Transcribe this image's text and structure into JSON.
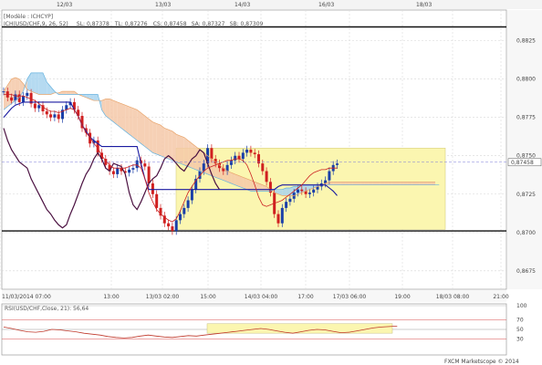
{
  "header": {
    "dates": [
      "12/03",
      "13/03",
      "14/03",
      "16/03",
      "18/03"
    ],
    "model_label": "[Modèle : ICHCYP]",
    "legend": [
      {
        "text": "ICH(USD/CHF,9, 26, 52)",
        "color": "#cc2222"
      },
      {
        "text": "SL: 0,87378",
        "color": "#cc2222"
      },
      {
        "text": "TL: 0,87276",
        "color": "#1a1aa0"
      },
      {
        "text": "CS: 0,87458",
        "color": "#333333"
      },
      {
        "text": "SA: 0,87327",
        "color": "#e08a3a"
      },
      {
        "text": "SB: 0,87309",
        "color": "#4aa3d8"
      }
    ]
  },
  "price_axis": {
    "ticks": [
      "0,8825",
      "0,8800",
      "0,8775",
      "0,8750",
      "0,8725",
      "0,8700",
      "0,8675"
    ],
    "current_price": "0,87458"
  },
  "time_axis": {
    "labels": [
      "11/03/2014 07:00",
      "13:00",
      "13/03 02:00",
      "15:00",
      "14/03 04:00",
      "17:00",
      "17/03 06:00",
      "19:00",
      "18/03 08:00",
      "21:00"
    ]
  },
  "rsi_panel": {
    "title": "RSI(USD/CHF,Close, 21): 56,64",
    "levels": [
      "100",
      "70",
      "50",
      "30"
    ]
  },
  "footer": {
    "copyright": "FXCM Marketscope © 2014"
  },
  "colors": {
    "bull_candle": "#1a3fa8",
    "bear_candle": "#d02020",
    "kijun": "#1a1aa0",
    "tenkan": "#cc2222",
    "chikou": "#4a1040",
    "kumo_bull_fill": "#f5c8a8",
    "kumo_bear_fill": "#a8d4ee",
    "highlight_box": "#fbf6b0"
  },
  "chart_data": {
    "type": "line",
    "title": "",
    "ylim": [
      0.8663,
      0.8845
    ],
    "series": [
      {
        "name": "",
        "kind": "close",
        "values": [
          0.8792,
          0.8788,
          0.8786,
          0.879,
          0.8785,
          0.8789,
          0.8791,
          0.8784,
          0.8781,
          0.8783,
          0.8779,
          0.8777,
          0.8775,
          0.8777,
          0.8774,
          0.878,
          0.8783,
          0.8785,
          0.878,
          0.8776,
          0.8768,
          0.8765,
          0.8758,
          0.876,
          0.8752,
          0.8748,
          0.8744,
          0.874,
          0.8738,
          0.8742,
          0.874,
          0.8739,
          0.8741,
          0.8742,
          0.8747,
          0.8745,
          0.8743,
          0.8732,
          0.8725,
          0.8716,
          0.8711,
          0.8706,
          0.8704,
          0.8701,
          0.8708,
          0.8712,
          0.8716,
          0.8721,
          0.8728,
          0.8735,
          0.874,
          0.8745,
          0.8755,
          0.8748,
          0.8745,
          0.8742,
          0.874,
          0.8744,
          0.8747,
          0.875,
          0.8748,
          0.8752,
          0.8754,
          0.8752,
          0.8751,
          0.8745,
          0.874,
          0.8733,
          0.8726,
          0.8712,
          0.8706,
          0.8716,
          0.872,
          0.8722,
          0.8726,
          0.8728,
          0.8727,
          0.8725,
          0.8726,
          0.8728,
          0.873,
          0.8732,
          0.8734,
          0.874,
          0.8744,
          0.8745
        ]
      },
      {
        "name": "",
        "kind": "tenkan",
        "values": [
          0.879,
          0.879,
          0.879,
          0.8789,
          0.8789,
          0.8789,
          0.8788,
          0.8787,
          0.8786,
          0.8784,
          0.8782,
          0.878,
          0.8779,
          0.8779,
          0.8778,
          0.8779,
          0.878,
          0.8781,
          0.878,
          0.8776,
          0.877,
          0.8765,
          0.8762,
          0.8758,
          0.8755,
          0.875,
          0.8747,
          0.8744,
          0.8742,
          0.8742,
          0.8742,
          0.8742,
          0.8743,
          0.8744,
          0.8744,
          0.8742,
          0.8735,
          0.8726,
          0.872,
          0.8715,
          0.8712,
          0.871,
          0.8708,
          0.8707,
          0.8709,
          0.8714,
          0.872,
          0.8726,
          0.873,
          0.8734,
          0.8737,
          0.874,
          0.8742,
          0.8743,
          0.8744,
          0.8745,
          0.8746,
          0.8747,
          0.8747,
          0.8748,
          0.8748,
          0.8747,
          0.8744,
          0.8738,
          0.8731,
          0.8723,
          0.8718,
          0.8717,
          0.8718,
          0.8719,
          0.872,
          0.8721,
          0.8723,
          0.8725,
          0.8727,
          0.8729,
          0.8731,
          0.8734,
          0.8737,
          0.8739,
          0.874,
          0.8741,
          0.8741,
          0.8742,
          0.8742,
          0.8742
        ]
      },
      {
        "name": "",
        "kind": "kijun",
        "values": [
          0.8775,
          0.8778,
          0.8781,
          0.8783,
          0.8784,
          0.8785,
          0.8785,
          0.8785,
          0.8785,
          0.8785,
          0.8785,
          0.8785,
          0.8785,
          0.8785,
          0.8785,
          0.8785,
          0.8785,
          0.8785,
          0.878,
          0.8776,
          0.877,
          0.8766,
          0.8762,
          0.876,
          0.8758,
          0.8756,
          0.8756,
          0.8756,
          0.8756,
          0.8756,
          0.8756,
          0.8756,
          0.8756,
          0.8756,
          0.8756,
          0.8745,
          0.8735,
          0.8728,
          0.8728,
          0.8728,
          0.8728,
          0.8728,
          0.8728,
          0.8728,
          0.8728,
          0.8728,
          0.8728,
          0.8728,
          0.8728,
          0.8728,
          0.8728,
          0.8728,
          0.8728,
          0.8728,
          0.8728,
          0.8728,
          0.8728,
          0.8728,
          0.8728,
          0.8728,
          0.8728,
          0.8728,
          0.8728,
          0.8728,
          0.8728,
          0.8728,
          0.8728,
          0.8728,
          0.8728,
          0.8728,
          0.873,
          0.8731,
          0.8731,
          0.8731,
          0.8731,
          0.8731,
          0.8731,
          0.8731,
          0.8731,
          0.8731,
          0.8731,
          0.8731,
          0.8731,
          0.8729,
          0.8727,
          0.8724
        ]
      },
      {
        "name": "",
        "kind": "chikou",
        "values": [
          0.8768,
          0.876,
          0.8754,
          0.875,
          0.8746,
          0.8744,
          0.8742,
          0.8735,
          0.873,
          0.8725,
          0.872,
          0.8715,
          0.8712,
          0.8708,
          0.8705,
          0.8703,
          0.8705,
          0.8712,
          0.8718,
          0.8725,
          0.8732,
          0.8738,
          0.8742,
          0.8748,
          0.8752,
          0.8748,
          0.8742,
          0.874,
          0.8745,
          0.8744,
          0.8743,
          0.8738,
          0.8726,
          0.8718,
          0.8715,
          0.872,
          0.8726,
          0.8732,
          0.8735,
          0.8737,
          0.8742,
          0.8748,
          0.875,
          0.8748,
          0.8745,
          0.8742,
          0.874,
          0.8744,
          0.8748,
          0.875,
          0.8754,
          0.8752,
          0.8745,
          0.8738,
          0.8732,
          0.8728
        ]
      },
      {
        "name": "",
        "kind": "senkou_a",
        "values": [
          0.8792,
          0.8796,
          0.88,
          0.8801,
          0.88,
          0.8797,
          0.8793,
          0.8792,
          0.8791,
          0.879,
          0.879,
          0.879,
          0.879,
          0.8791,
          0.8791,
          0.8792,
          0.8792,
          0.8792,
          0.8792,
          0.879,
          0.8789,
          0.8788,
          0.8787,
          0.8786,
          0.8786,
          0.8786,
          0.8787,
          0.8787,
          0.8786,
          0.8785,
          0.8784,
          0.8783,
          0.8782,
          0.8781,
          0.878,
          0.8778,
          0.8776,
          0.8774,
          0.8772,
          0.8771,
          0.877,
          0.8768,
          0.8767,
          0.8766,
          0.8764,
          0.8763,
          0.8762,
          0.876,
          0.8758,
          0.8756,
          0.8754,
          0.8752,
          0.875,
          0.8748,
          0.8746,
          0.8744,
          0.8742,
          0.874,
          0.8739,
          0.8738,
          0.8737,
          0.8736,
          0.8735,
          0.8734,
          0.8733,
          0.8732,
          0.8731,
          0.873,
          0.8728,
          0.8726,
          0.8725,
          0.8724,
          0.8724,
          0.8724,
          0.8724,
          0.8725,
          0.8726,
          0.8727,
          0.8728,
          0.8729,
          0.873,
          0.8731,
          0.8732,
          0.8733,
          0.8733,
          0.8733,
          0.8733,
          0.8733,
          0.8733,
          0.8733,
          0.8733,
          0.8733,
          0.8733,
          0.8733,
          0.8733,
          0.8733,
          0.8733,
          0.8733,
          0.8733,
          0.8733,
          0.8733,
          0.8733,
          0.8733,
          0.8733,
          0.8733,
          0.8733,
          0.8733,
          0.8733,
          0.8733,
          0.8733,
          0.8733
        ]
      },
      {
        "name": "",
        "kind": "senkou_b",
        "values": [
          0.878,
          0.8782,
          0.8784,
          0.8786,
          0.8788,
          0.8792,
          0.88,
          0.8804,
          0.8804,
          0.8804,
          0.8804,
          0.8798,
          0.8795,
          0.8792,
          0.879,
          0.879,
          0.879,
          0.879,
          0.879,
          0.879,
          0.879,
          0.879,
          0.879,
          0.879,
          0.879,
          0.878,
          0.8776,
          0.8774,
          0.8772,
          0.877,
          0.8768,
          0.8766,
          0.8764,
          0.8762,
          0.876,
          0.8758,
          0.8756,
          0.8754,
          0.8752,
          0.8751,
          0.875,
          0.8749,
          0.8748,
          0.8747,
          0.8746,
          0.8745,
          0.8744,
          0.8743,
          0.8742,
          0.8741,
          0.874,
          0.8739,
          0.8738,
          0.8737,
          0.8736,
          0.8735,
          0.8734,
          0.8733,
          0.8732,
          0.8731,
          0.873,
          0.8729,
          0.8728,
          0.8727,
          0.8727,
          0.8727,
          0.8727,
          0.8727,
          0.8727,
          0.8728,
          0.8728,
          0.8728,
          0.8729,
          0.8729,
          0.873,
          0.873,
          0.8731,
          0.8731,
          0.8731,
          0.8731,
          0.8731,
          0.8731,
          0.8731,
          0.8731,
          0.8731,
          0.8731,
          0.8731,
          0.8731,
          0.8731,
          0.8731,
          0.8731,
          0.8731,
          0.8731,
          0.8731,
          0.8731,
          0.8731,
          0.8731,
          0.8731,
          0.8731,
          0.8731,
          0.8731,
          0.8731,
          0.8731,
          0.8731,
          0.8731,
          0.8731,
          0.8731,
          0.8731,
          0.8731,
          0.8731,
          0.8731,
          0.8731
        ]
      },
      {
        "name": "",
        "kind": "rsi",
        "values": [
          55,
          52,
          48,
          45,
          44,
          46,
          50,
          49,
          47,
          45,
          42,
          40,
          38,
          35,
          33,
          32,
          33,
          36,
          38,
          36,
          34,
          33,
          35,
          37,
          36,
          38,
          40,
          42,
          44,
          46,
          48,
          50,
          52,
          50,
          47,
          44,
          42,
          45,
          48,
          50,
          49,
          46,
          43,
          44,
          47,
          50,
          53,
          55,
          56,
          57
        ]
      }
    ],
    "horizontal_lines": [
      0.8834,
      0.8701
    ],
    "rsi_ylim": [
      0,
      100
    ]
  }
}
